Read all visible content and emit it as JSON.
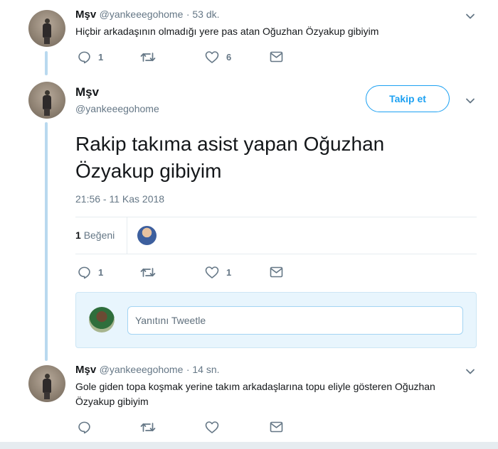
{
  "tweets": [
    {
      "name": "Mşv",
      "handle": "@yankeeegohome",
      "time": "· 53 dk.",
      "text": "Hiçbir arkadaşının olmadığı yere pas atan Oğuzhan Özyakup gibiyim",
      "replies": "1",
      "retweets": "",
      "likes": "6"
    },
    {
      "name": "Mşv",
      "handle": "@yankeeegohome",
      "follow_label": "Takip et",
      "text_line1": "Rakip takıma asist yapan Oğuzhan",
      "text_line2": "Özyakup gibiyim",
      "timestamp": "21:56 - 11 Kas 2018",
      "like_count": "1",
      "like_label": "Beğeni",
      "replies": "1",
      "retweets": "",
      "likes": "1"
    },
    {
      "name": "Mşv",
      "handle": "@yankeeegohome",
      "time": "· 14 sn.",
      "text_line1": "Gole giden topa koşmak yerine takım arkadaşlarına topu eliyle gösteren Oğuzhan",
      "text_line2": "Özyakup gibiyim",
      "replies": "",
      "retweets": "",
      "likes": ""
    }
  ],
  "reply_box": {
    "placeholder": "Yanıtını Tweetle"
  },
  "icons": {
    "reply": "reply-icon",
    "retweet": "retweet-icon",
    "like": "heart-icon",
    "dm": "envelope-icon",
    "more": "chevron-down-icon"
  },
  "colors": {
    "accent": "#1da1f2",
    "muted": "#657786",
    "thread_line": "#b9d9ef"
  }
}
